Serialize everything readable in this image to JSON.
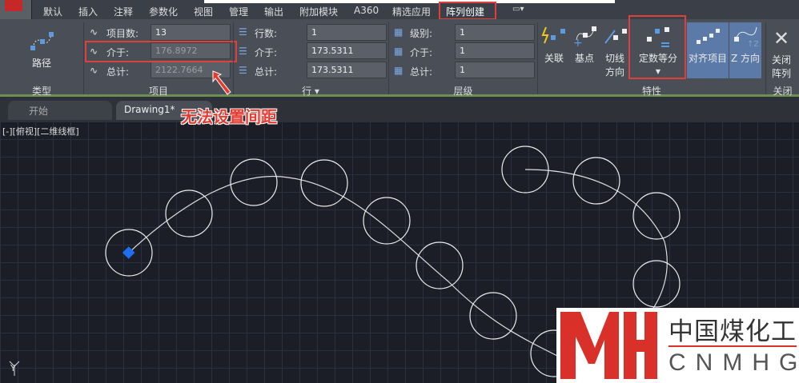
{
  "tabs": [
    "默认",
    "插入",
    "注释",
    "参数化",
    "视图",
    "管理",
    "输出",
    "附加模块",
    "A360",
    "精选应用",
    "阵列创建"
  ],
  "ribbon": {
    "type_panel": {
      "title": "类型",
      "button": "路径"
    },
    "items_panel": {
      "title": "项目",
      "count_label": "项目数:",
      "count_value": "13",
      "between_label": "介于:",
      "between_value": "176.8972",
      "total_label": "总计:",
      "total_value": "2122.7664"
    },
    "rows_panel": {
      "title": "行 ▾",
      "rows_label": "行数:",
      "rows_value": "1",
      "between_label": "介于:",
      "between_value": "173.5311",
      "total_label": "总计:",
      "total_value": "173.5311"
    },
    "levels_panel": {
      "title": "层级",
      "levels_label": "级别:",
      "levels_value": "1",
      "between_label": "介于:",
      "between_value": "1",
      "total_label": "总计:",
      "total_value": "1"
    },
    "properties_panel": {
      "title": "特性",
      "associative": "关联",
      "base_point": "基点",
      "tangent_1": "切线",
      "tangent_2": "方向",
      "measure": "定数等分",
      "align": "对齐项目",
      "z_dir": "Z 方向"
    },
    "close_panel": {
      "title": "关闭",
      "close_1": "关闭",
      "close_2": "阵列"
    }
  },
  "doc_tabs": [
    "开始",
    "Drawing1*"
  ],
  "viewport_label": "[-][俯视][二维线框]",
  "annotation": "无法设置间距",
  "axis_label": "Y",
  "watermark": {
    "cn": "中国煤化工",
    "en": "CNMHG",
    "logo": "MH"
  }
}
